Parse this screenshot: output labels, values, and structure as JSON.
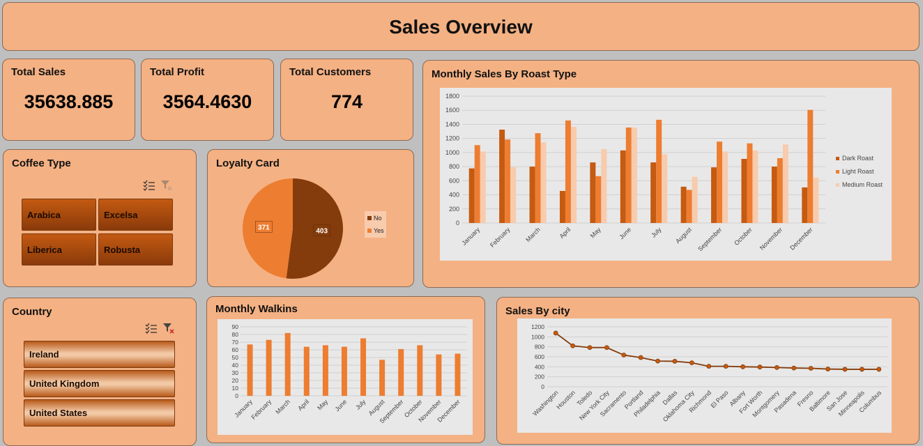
{
  "header": {
    "title": "Sales Overview"
  },
  "kpis": [
    {
      "label": "Total Sales",
      "value": "35638.885"
    },
    {
      "label": "Total Profit",
      "value": "3564.4630"
    },
    {
      "label": "Total Customers",
      "value": "774"
    }
  ],
  "coffee_type": {
    "title": "Coffee Type",
    "items": [
      "Arabica",
      "Excelsa",
      "Liberica",
      "Robusta"
    ]
  },
  "country": {
    "title": "Country",
    "items": [
      "Ireland",
      "United Kingdom",
      "United States"
    ]
  },
  "icons": [
    "multi-select-icon",
    "clear-filter-icon"
  ],
  "colors": {
    "panel": "#f4b183",
    "dark_roast": "#c55a11",
    "light_roast": "#ed7d31",
    "medium_roast": "#f8cbad",
    "loyalty_no": "#843c0c",
    "loyalty_yes": "#ed7d31"
  },
  "loyalty": {
    "title": "Loyalty Card"
  },
  "roast": {
    "title": "Monthly Sales By Roast Type"
  },
  "walkins": {
    "title": "Monthly Walkins"
  },
  "city": {
    "title": "Sales By city"
  },
  "chart_data": [
    {
      "type": "pie",
      "title": "Loyalty Card",
      "categories": [
        "No",
        "Yes"
      ],
      "values": [
        403,
        371
      ],
      "legend": "right"
    },
    {
      "type": "bar",
      "title": "Monthly Sales By Roast Type",
      "categories": [
        "January",
        "February",
        "March",
        "April",
        "May",
        "June",
        "July",
        "August",
        "September",
        "October",
        "November",
        "December"
      ],
      "series": [
        {
          "name": "Dark Roast",
          "values": [
            775,
            1325,
            800,
            455,
            860,
            1030,
            860,
            515,
            790,
            910,
            800,
            505
          ]
        },
        {
          "name": "Light Roast",
          "values": [
            1105,
            1185,
            1275,
            1455,
            665,
            1355,
            1465,
            470,
            1155,
            1130,
            920,
            1605
          ]
        },
        {
          "name": "Medium Roast",
          "values": [
            1015,
            790,
            1145,
            1365,
            1050,
            1355,
            975,
            655,
            1015,
            1030,
            1115,
            645
          ]
        }
      ],
      "ylim": [
        0,
        1800
      ],
      "yticks": [
        0,
        200,
        400,
        600,
        800,
        1000,
        1200,
        1400,
        1600,
        1800
      ],
      "grid": true,
      "legend": "right"
    },
    {
      "type": "bar",
      "title": "Monthly Walkins",
      "categories": [
        "January",
        "February",
        "March",
        "April",
        "May",
        "June",
        "July",
        "August",
        "September",
        "October",
        "November",
        "December"
      ],
      "values": [
        67,
        73,
        82,
        64,
        66,
        64,
        75,
        47,
        61,
        66,
        54,
        55
      ],
      "ylim": [
        0,
        90
      ],
      "yticks": [
        0,
        10,
        20,
        30,
        40,
        50,
        60,
        70,
        80,
        90
      ],
      "grid": true
    },
    {
      "type": "line",
      "title": "Sales By city",
      "categories": [
        "Washington",
        "Houston",
        "Toledo",
        "New York City",
        "Sacramento",
        "Portland",
        "Philadelphia",
        "Dallas",
        "Oklahoma City",
        "Richmond",
        "El Paso",
        "Albany",
        "Fort Worth",
        "Montgomery",
        "Pasadena",
        "Fresno",
        "Baltimore",
        "San Jose",
        "Minneapolis",
        "Columbus"
      ],
      "values": [
        1075,
        820,
        785,
        785,
        635,
        585,
        515,
        510,
        480,
        410,
        410,
        400,
        395,
        385,
        375,
        370,
        355,
        350,
        350,
        350
      ],
      "ylim": [
        0,
        1200
      ],
      "yticks": [
        0,
        200,
        400,
        600,
        800,
        1000,
        1200
      ],
      "grid": true
    }
  ]
}
